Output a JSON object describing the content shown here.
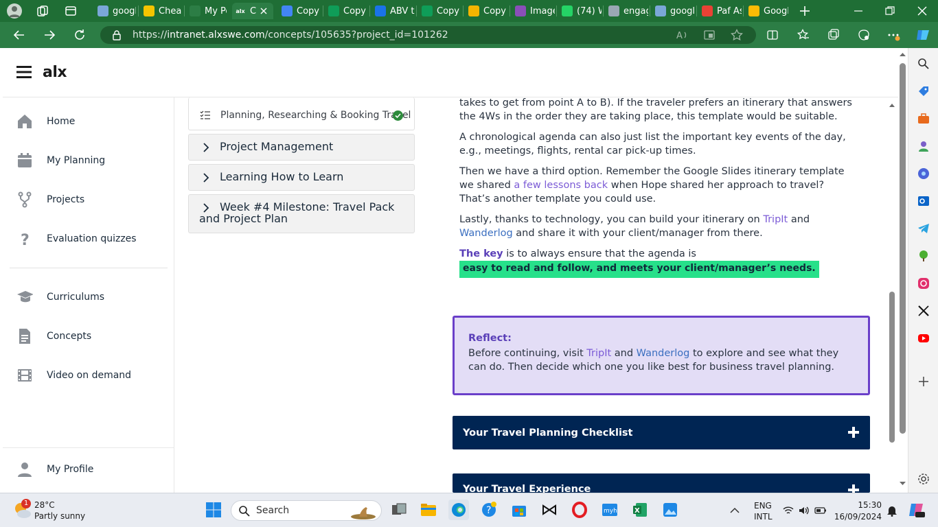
{
  "browser": {
    "tabs": [
      {
        "label": "googl",
        "color": "#7aa7d8"
      },
      {
        "label": "Cheap",
        "color": "#f5c400"
      },
      {
        "label": "My Po",
        "color": "#2c7d45"
      },
      {
        "label": "C",
        "color": "#2c7d45"
      },
      {
        "label": "Copy c",
        "color": "#4285f4"
      },
      {
        "label": "Copy c",
        "color": "#0f9d58"
      },
      {
        "label": "ABV to",
        "color": "#1a73e8"
      },
      {
        "label": "Copy c",
        "color": "#0f9d58"
      },
      {
        "label": "Copy c",
        "color": "#f4b400"
      },
      {
        "label": "Image",
        "color": "#8a4fb8"
      },
      {
        "label": "(74) W",
        "color": "#25d366"
      },
      {
        "label": "engag",
        "color": "#9aa7b4"
      },
      {
        "label": "googl",
        "color": "#7aa7d8"
      },
      {
        "label": "Paf As",
        "color": "#e94235"
      },
      {
        "label": "Googl",
        "color": "#fbbc05"
      }
    ],
    "active_tab_logo": "alx",
    "url_prefix": "https://",
    "url_host": "intranet.alxswe.com",
    "url_path": "/concepts/105635?project_id=101262",
    "accent": "#2c7d45"
  },
  "app": {
    "logo": "alx",
    "nav": [
      {
        "label": "Home",
        "icon": "home-icon"
      },
      {
        "label": "My Planning",
        "icon": "calendar-icon"
      },
      {
        "label": "Projects",
        "icon": "fork-icon"
      },
      {
        "label": "Evaluation quizzes",
        "icon": "question-icon"
      }
    ],
    "nav2": [
      {
        "label": "Curriculums",
        "icon": "graduation-cap-icon"
      },
      {
        "label": "Concepts",
        "icon": "document-icon"
      },
      {
        "label": "Video on demand",
        "icon": "film-icon"
      }
    ],
    "profile": "My Profile"
  },
  "accordion": {
    "current_item": "Planning, Researching & Booking Travel",
    "sections": [
      "Project Management",
      "Learning How to Learn",
      "Week #4 Milestone: Travel Pack and Project Plan"
    ]
  },
  "content": {
    "p1": "takes to get from point A to B). If the traveler prefers an itinerary that answers the 4Ws in the order they are taking place, this template would be suitable.",
    "p2": "A chronological agenda can also just list the important key events of the day, e.g., meetings, flights, rental car pick-up times.",
    "p3a": "Then we have a third option. Remember the Google Slides itinerary template we shared ",
    "p3link": "a few lessons back",
    "p3b": " when Hope shared her approach to travel? That’s another template you could use.",
    "p4a": "Lastly, thanks to technology, you can build your itinerary on ",
    "p4link1": "TripIt",
    "p4mid": " and ",
    "p4link2": "Wanderlog",
    "p4b": " and share it with your client/manager from there.",
    "key_bold": "The key",
    "key_rest": " is to always ensure that the agenda is",
    "highlight": "easy to read and follow, and meets your client/manager’s needs.",
    "reflect_title": "Reflect:",
    "reflect_a": "Before continuing, visit ",
    "reflect_link1": "TripIt",
    "reflect_mid": " and ",
    "reflect_link2": "Wanderlog",
    "reflect_b": " to explore and see what they can do. Then decide which one you like best for business travel planning.",
    "checklist": "Your Travel Planning Checklist",
    "experience": "Your Travel Experience"
  },
  "taskbar": {
    "weather_temp": "28°C",
    "weather_desc": "Partly sunny",
    "weather_badge": "1",
    "search": "Search",
    "lang1": "ENG",
    "lang2": "INTL",
    "time": "15:30",
    "date": "16/09/2024"
  }
}
